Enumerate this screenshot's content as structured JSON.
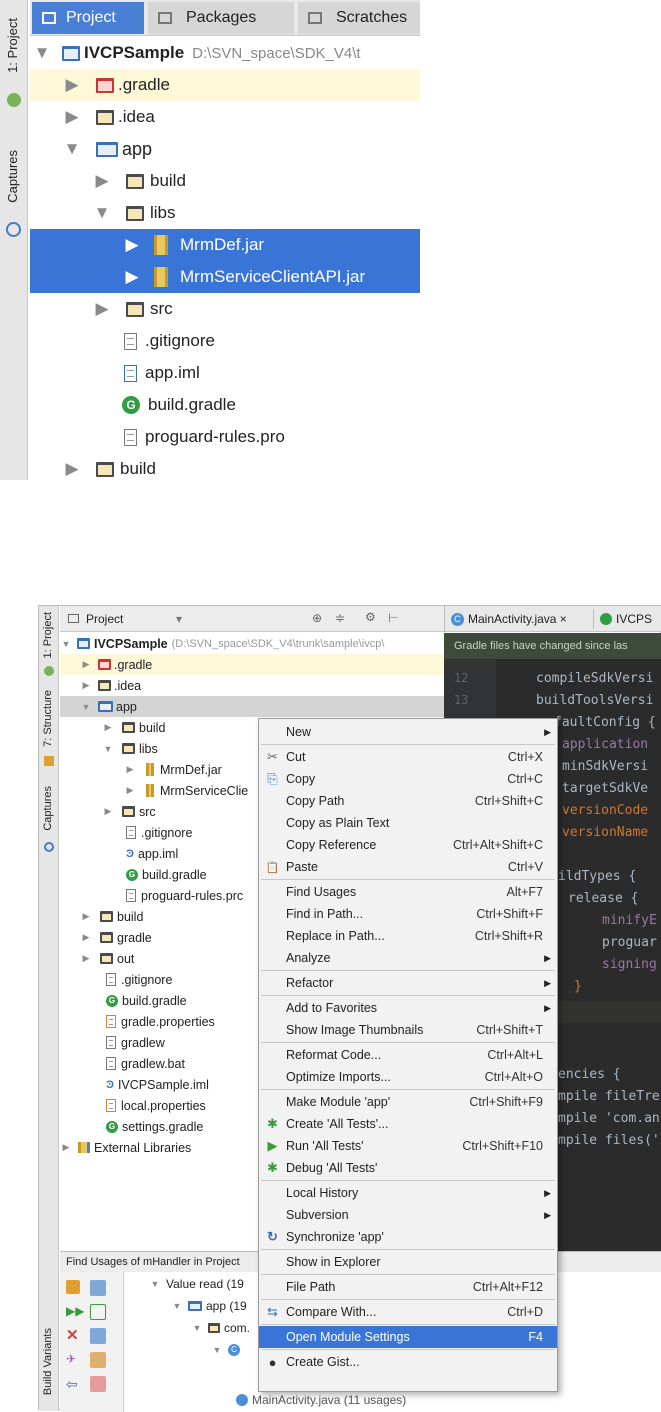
{
  "top": {
    "side_tabs": [
      "1: Project",
      "Captures"
    ],
    "tabs": [
      "Project",
      "Packages",
      "Scratches"
    ],
    "root_name": "IVCPSample",
    "root_path": "D:\\SVN_space\\SDK_V4\\t",
    "items": [
      ".gradle",
      ".idea",
      "app",
      "build",
      "libs",
      "MrmDef.jar",
      "MrmServiceClientAPI.jar",
      "src",
      ".gitignore",
      "app.iml",
      "build.gradle",
      "proguard-rules.pro",
      "build"
    ]
  },
  "bottom": {
    "side_tabs": [
      "1: Project",
      "7: Structure",
      "Captures",
      "Build Variants"
    ],
    "header": {
      "title": "Project",
      "dropdown_icon": "▾"
    },
    "editor_tabs": [
      "MainActivity.java ×",
      "IVCPS"
    ],
    "notification": "Gradle files have changed since las",
    "line_numbers": [
      "12",
      "13"
    ],
    "code_lines": [
      "compileSdkVersi",
      "buildToolsVersi",
      "faultConfig {",
      "application",
      "minSdkVersi",
      "targetSdkVe",
      "versionCode",
      "versionName",
      "ildTypes {",
      "release {",
      "minifyE",
      "proguar",
      "signing",
      "}",
      "encies {",
      "mpile fileTre",
      "mpile 'com.an",
      "mpile files('"
    ],
    "tree": {
      "root_name": "IVCPSample",
      "root_path": "(D:\\SVN_space\\SDK_V4\\trunk\\sample\\ivcp\\",
      "items": [
        ".gradle",
        ".idea",
        "app",
        "build",
        "libs",
        "MrmDef.jar",
        "MrmServiceClie",
        "src",
        ".gitignore",
        "app.iml",
        "build.gradle",
        "proguard-rules.prc",
        "build",
        "gradle",
        "out",
        ".gitignore",
        "build.gradle",
        "gradle.properties",
        "gradlew",
        "gradlew.bat",
        "IVCPSample.iml",
        "local.properties",
        "settings.gradle",
        "External Libraries"
      ]
    },
    "find": {
      "title": "Find Usages of mHandler in Project",
      "items": [
        "Value read (19",
        "app (19",
        "com.",
        "C",
        "MainActivity.java (11 usages)"
      ]
    },
    "menu": [
      {
        "label": "New",
        "shortcut": "",
        "submenu": true
      },
      {
        "label": "Cut",
        "shortcut": "Ctrl+X",
        "icon": "✂"
      },
      {
        "label": "Copy",
        "shortcut": "Ctrl+C",
        "icon": "⎘"
      },
      {
        "label": "Copy Path",
        "shortcut": "Ctrl+Shift+C"
      },
      {
        "label": "Copy as Plain Text",
        "shortcut": ""
      },
      {
        "label": "Copy Reference",
        "shortcut": "Ctrl+Alt+Shift+C"
      },
      {
        "label": "Paste",
        "shortcut": "Ctrl+V",
        "icon": "📋"
      },
      {
        "label": "Find Usages",
        "shortcut": "Alt+F7"
      },
      {
        "label": "Find in Path...",
        "shortcut": "Ctrl+Shift+F"
      },
      {
        "label": "Replace in Path...",
        "shortcut": "Ctrl+Shift+R"
      },
      {
        "label": "Analyze",
        "shortcut": "",
        "submenu": true
      },
      {
        "label": "Refactor",
        "shortcut": "",
        "submenu": true
      },
      {
        "label": "Add to Favorites",
        "shortcut": "",
        "submenu": true
      },
      {
        "label": "Show Image Thumbnails",
        "shortcut": "Ctrl+Shift+T"
      },
      {
        "label": "Reformat Code...",
        "shortcut": "Ctrl+Alt+L"
      },
      {
        "label": "Optimize Imports...",
        "shortcut": "Ctrl+Alt+O"
      },
      {
        "label": "Make Module 'app'",
        "shortcut": "Ctrl+Shift+F9"
      },
      {
        "label": "Create 'All Tests'...",
        "shortcut": "",
        "icon": "✱"
      },
      {
        "label": "Run 'All Tests'",
        "shortcut": "Ctrl+Shift+F10",
        "icon": "▶"
      },
      {
        "label": "Debug 'All Tests'",
        "shortcut": "",
        "icon": "✱"
      },
      {
        "label": "Local History",
        "shortcut": "",
        "submenu": true
      },
      {
        "label": "Subversion",
        "shortcut": "",
        "submenu": true
      },
      {
        "label": "Synchronize 'app'",
        "shortcut": "",
        "icon": "↻"
      },
      {
        "label": "Show in Explorer",
        "shortcut": ""
      },
      {
        "label": "File Path",
        "shortcut": "Ctrl+Alt+F12"
      },
      {
        "label": "Compare With...",
        "shortcut": "Ctrl+D",
        "icon": "⇆"
      },
      {
        "label": "Open Module Settings",
        "shortcut": "F4",
        "selected": true
      },
      {
        "label": "Create Gist...",
        "shortcut": "",
        "icon": "●"
      }
    ]
  },
  "colors": {
    "selection": "#3875d7",
    "highlight_row": "#fdf8d8",
    "editor_bg": "#2b2b2b",
    "notification_bg": "#3c4a3f"
  }
}
